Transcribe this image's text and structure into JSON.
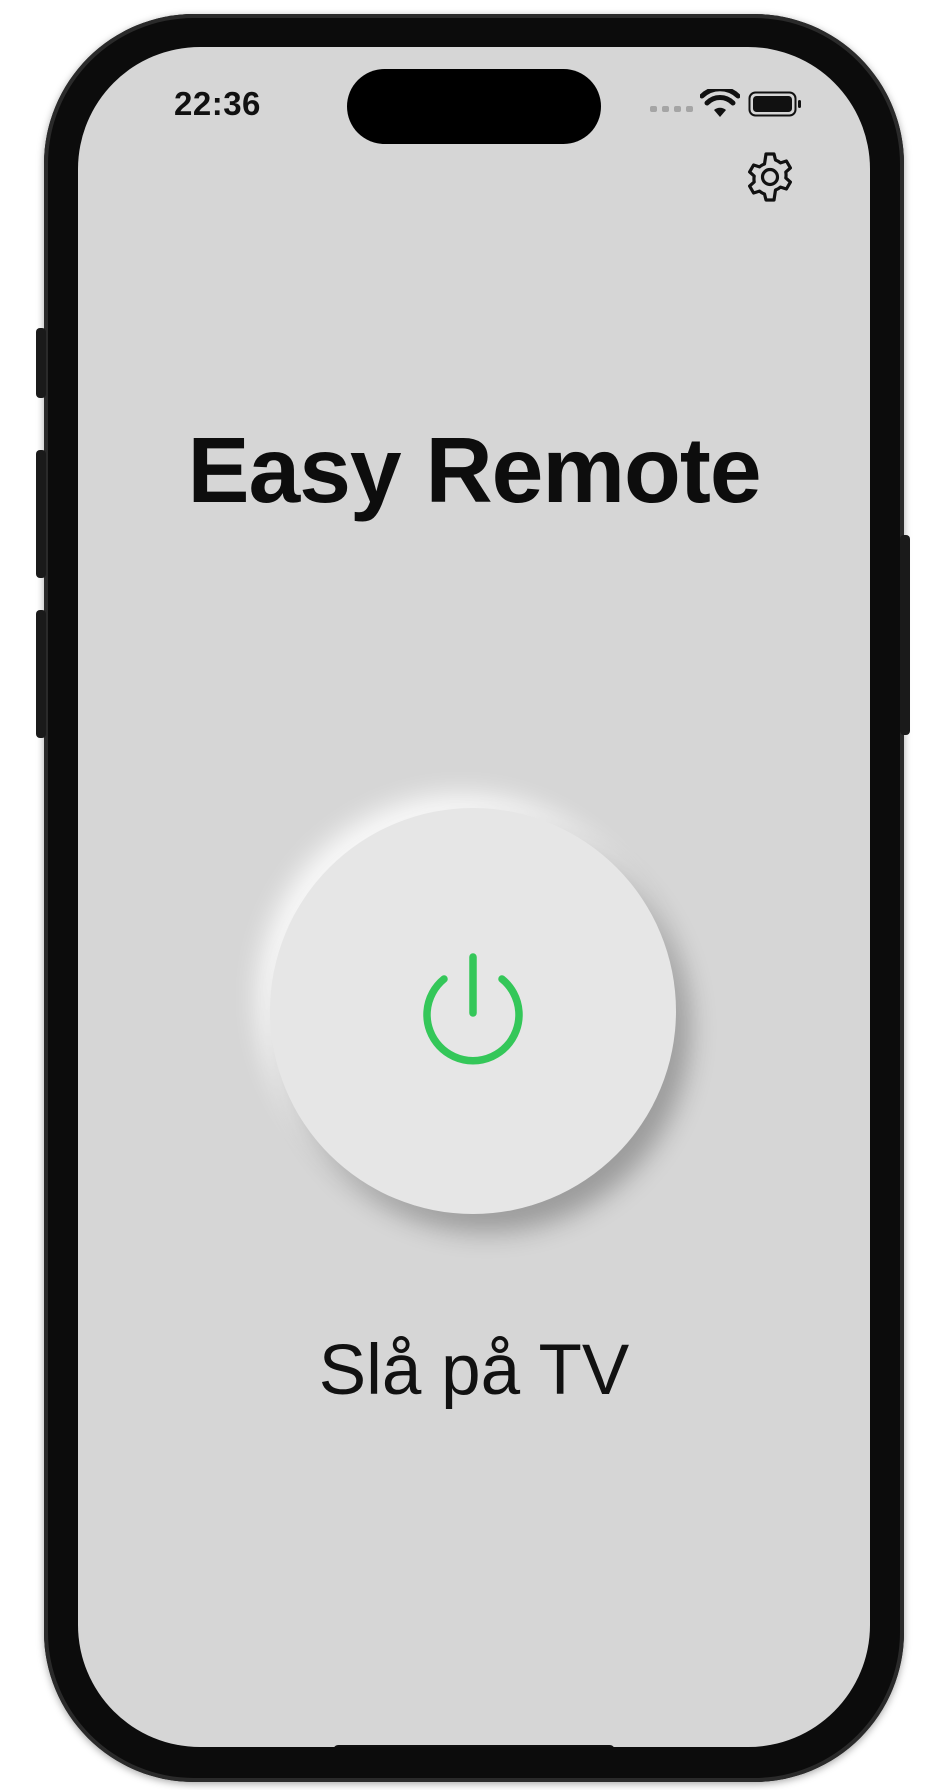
{
  "status_bar": {
    "time": "22:36",
    "wifi_icon": "wifi-icon",
    "battery_icon": "battery-full-icon",
    "signal_icon": "cellular-no-signal-icon"
  },
  "toolbar": {
    "settings_icon": "gear-icon"
  },
  "main": {
    "title": "Easy Remote",
    "power_button_icon": "power-icon",
    "action_label": "Slå på TV"
  },
  "colors": {
    "background": "#d6d6d6",
    "button_face": "#e6e6e6",
    "power_accent": "#34c759",
    "text": "#111111"
  }
}
